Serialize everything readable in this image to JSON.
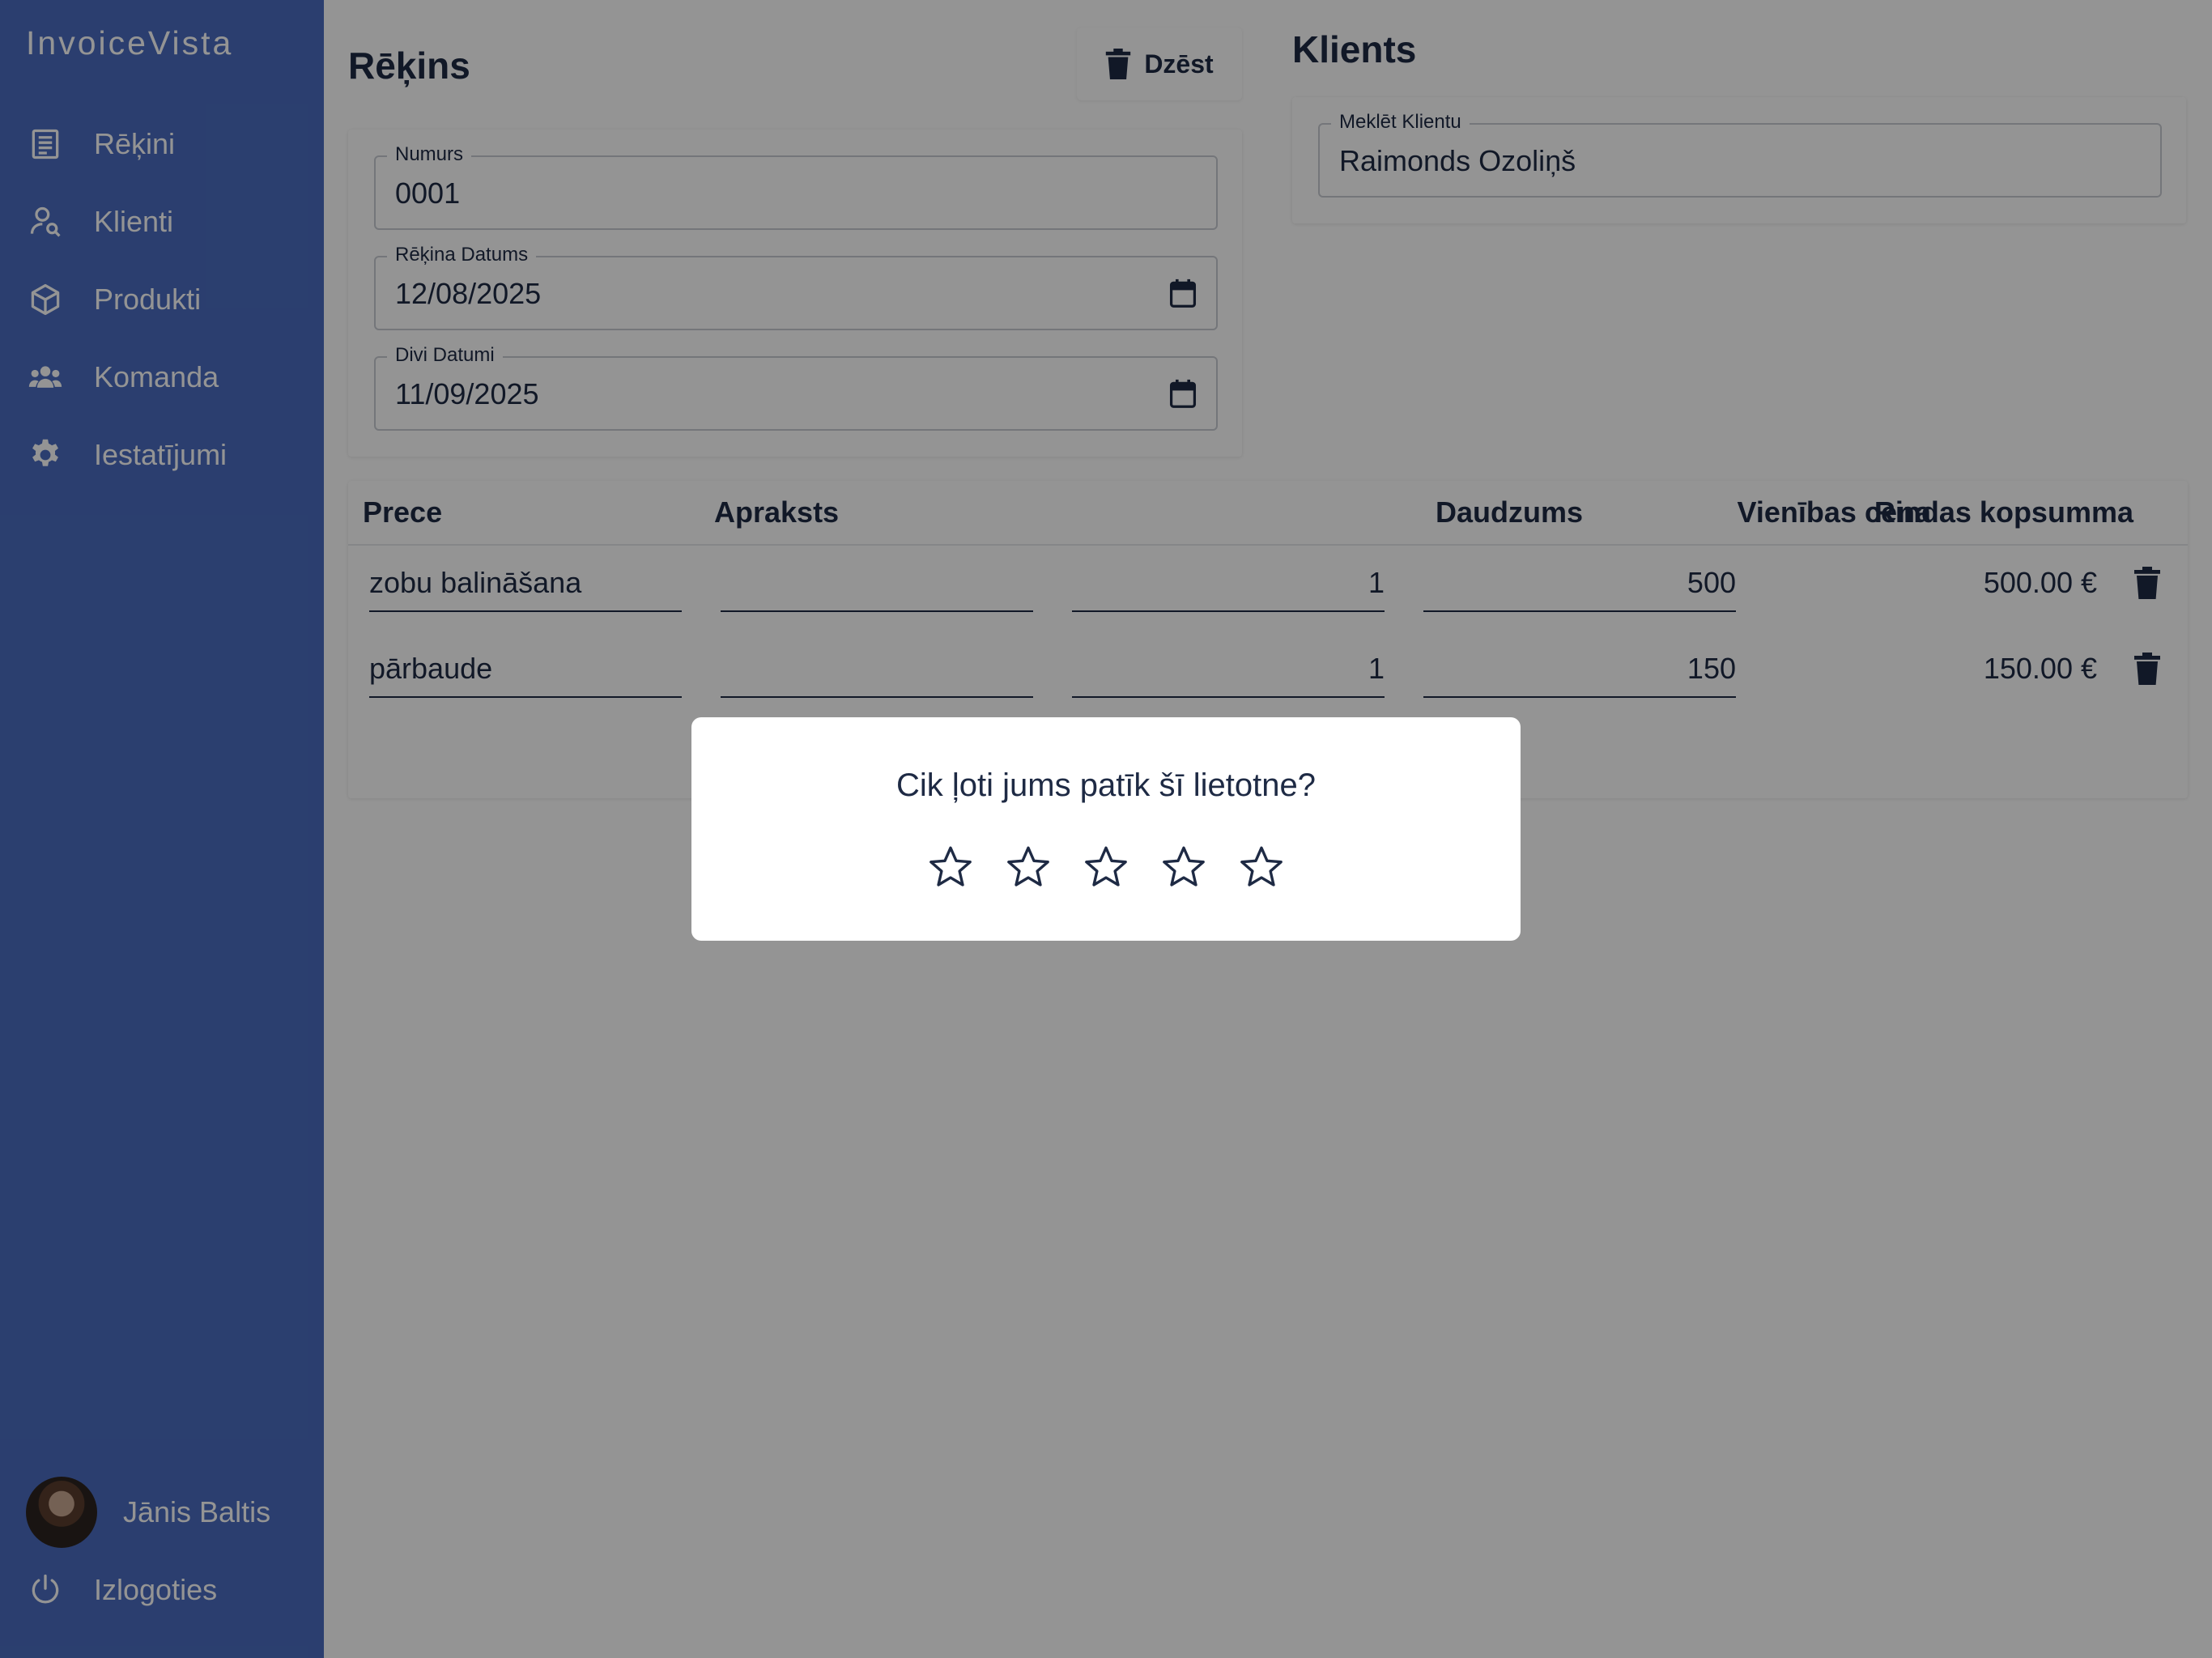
{
  "app": {
    "brand": "InvoiceVista"
  },
  "sidebar": {
    "items": [
      {
        "label": "Rēķini",
        "icon": "invoice-list-icon"
      },
      {
        "label": "Klienti",
        "icon": "user-search-icon"
      },
      {
        "label": "Produkti",
        "icon": "box-icon"
      },
      {
        "label": "Komanda",
        "icon": "team-icon"
      },
      {
        "label": "Iestatījumi",
        "icon": "gear-icon"
      }
    ],
    "user": {
      "name": "Jānis Baltis"
    },
    "logout": {
      "label": "Izlogoties",
      "icon": "power-icon"
    }
  },
  "invoice": {
    "title": "Rēķins",
    "delete_label": "Dzēst",
    "fields": {
      "number": {
        "label": "Numurs",
        "value": "0001"
      },
      "date": {
        "label": "Rēķina Datums",
        "value": "12/08/2025"
      },
      "due": {
        "label": "Divi Datumi",
        "value": "11/09/2025"
      }
    }
  },
  "client": {
    "title": "Klients",
    "search": {
      "label": "Meklēt Klientu",
      "value": "Raimonds Ozoliņš"
    }
  },
  "items": {
    "headers": {
      "item": "Prece",
      "description": "Apraksts",
      "quantity": "Daudzums",
      "unit_price": "Vienības cena",
      "line_total": "Rindas kopsumma"
    },
    "rows": [
      {
        "item": "zobu balināšana",
        "description": "",
        "quantity": "1",
        "unit_price": "500",
        "line_total": "500.00 €"
      },
      {
        "item": "pārbaude",
        "description": "",
        "quantity": "1",
        "unit_price": "150",
        "line_total": "150.00 €"
      }
    ]
  },
  "rating_modal": {
    "question": "Cik ļoti jums patīk šī lietotne?",
    "max_stars": 5,
    "selected": 0
  },
  "colors": {
    "sidebar": "#4a6cc0",
    "text": "#1e2a44",
    "overlay": "rgba(0,0,0,0.42)"
  }
}
